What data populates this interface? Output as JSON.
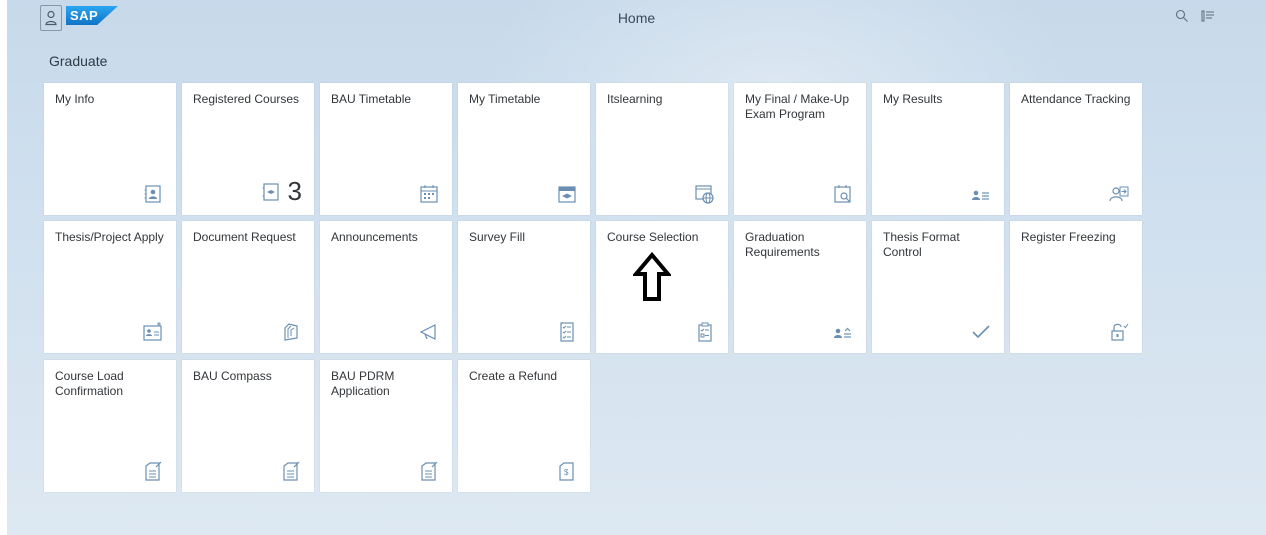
{
  "header": {
    "logo_text": "SAP",
    "title": "Home",
    "icons": [
      "person-icon",
      "search-icon",
      "menu-icon"
    ]
  },
  "group": {
    "title": "Graduate"
  },
  "tiles": [
    {
      "title": "My Info",
      "icon": "contact-card-icon"
    },
    {
      "title": "Registered Courses",
      "icon": "course-book-icon",
      "count": "3"
    },
    {
      "title": "BAU Timetable",
      "icon": "calendar-grid-icon"
    },
    {
      "title": "My Timetable",
      "icon": "calendar-education-icon"
    },
    {
      "title": "Itslearning",
      "icon": "web-window-icon"
    },
    {
      "title": "My Final / Make-Up Exam Program",
      "icon": "calendar-search-icon"
    },
    {
      "title": "My Results",
      "icon": "people-results-icon"
    },
    {
      "title": "Attendance Tracking",
      "icon": "user-arrow-icon"
    },
    {
      "title": "Thesis/Project Apply",
      "icon": "document-add-icon"
    },
    {
      "title": "Document Request",
      "icon": "documents-request-icon"
    },
    {
      "title": "Announcements",
      "icon": "megaphone-icon"
    },
    {
      "title": "Survey Fill",
      "icon": "checklist-icon"
    },
    {
      "title": "Course Selection",
      "icon": "clipboard-list-icon"
    },
    {
      "title": "Graduation Requirements",
      "icon": "person-requirements-icon"
    },
    {
      "title": "Thesis Format Control",
      "icon": "checkmark-icon"
    },
    {
      "title": "Register Freezing",
      "icon": "unlock-icon"
    },
    {
      "title": "Course Load Confirmation",
      "icon": "form-edit-icon"
    },
    {
      "title": "BAU Compass",
      "icon": "form-edit-icon"
    },
    {
      "title": "BAU PDRM Application",
      "icon": "form-edit-icon"
    },
    {
      "title": "Create a Refund",
      "icon": "refund-document-icon"
    }
  ],
  "annotation": {
    "icon": "outlined-up-arrow-icon"
  },
  "colors": {
    "icon_blue": "#6a8fb3",
    "text": "#32363a"
  }
}
